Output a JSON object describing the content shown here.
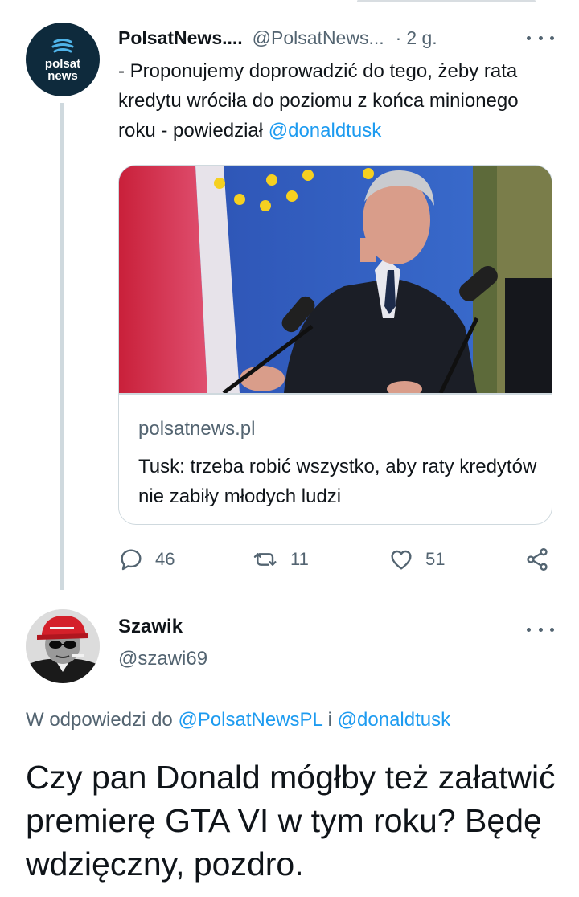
{
  "tweet1": {
    "avatar_text_line1": "polsat",
    "avatar_text_line2": "news",
    "display_name": "PolsatNews....",
    "handle": "@PolsatNews...",
    "separator": "·",
    "time": "2 g.",
    "text_prefix": "- Proponujemy doprowadzić do tego, żeby rata kredytu wróciła do poziomu z końca minionego roku - powiedział ",
    "text_mention": "@donaldtusk",
    "card": {
      "domain": "polsatnews.pl",
      "title": "Tusk: trzeba robić wszystko, aby raty kredytów nie zabiły młodych ludzi"
    },
    "actions": {
      "replies": "46",
      "retweets": "11",
      "likes": "51"
    }
  },
  "tweet2": {
    "display_name": "Szawik",
    "handle": "@szawi69",
    "reply_prefix": "W odpowiedzi do ",
    "reply_mention1": "@PolsatNewsPL",
    "reply_conjunction": " i ",
    "reply_mention2": "@donaldtusk",
    "text": "Czy pan Donald mógłby też załatwić premierę GTA VI w tym roku? Będę wdzięczny, pozdro."
  }
}
